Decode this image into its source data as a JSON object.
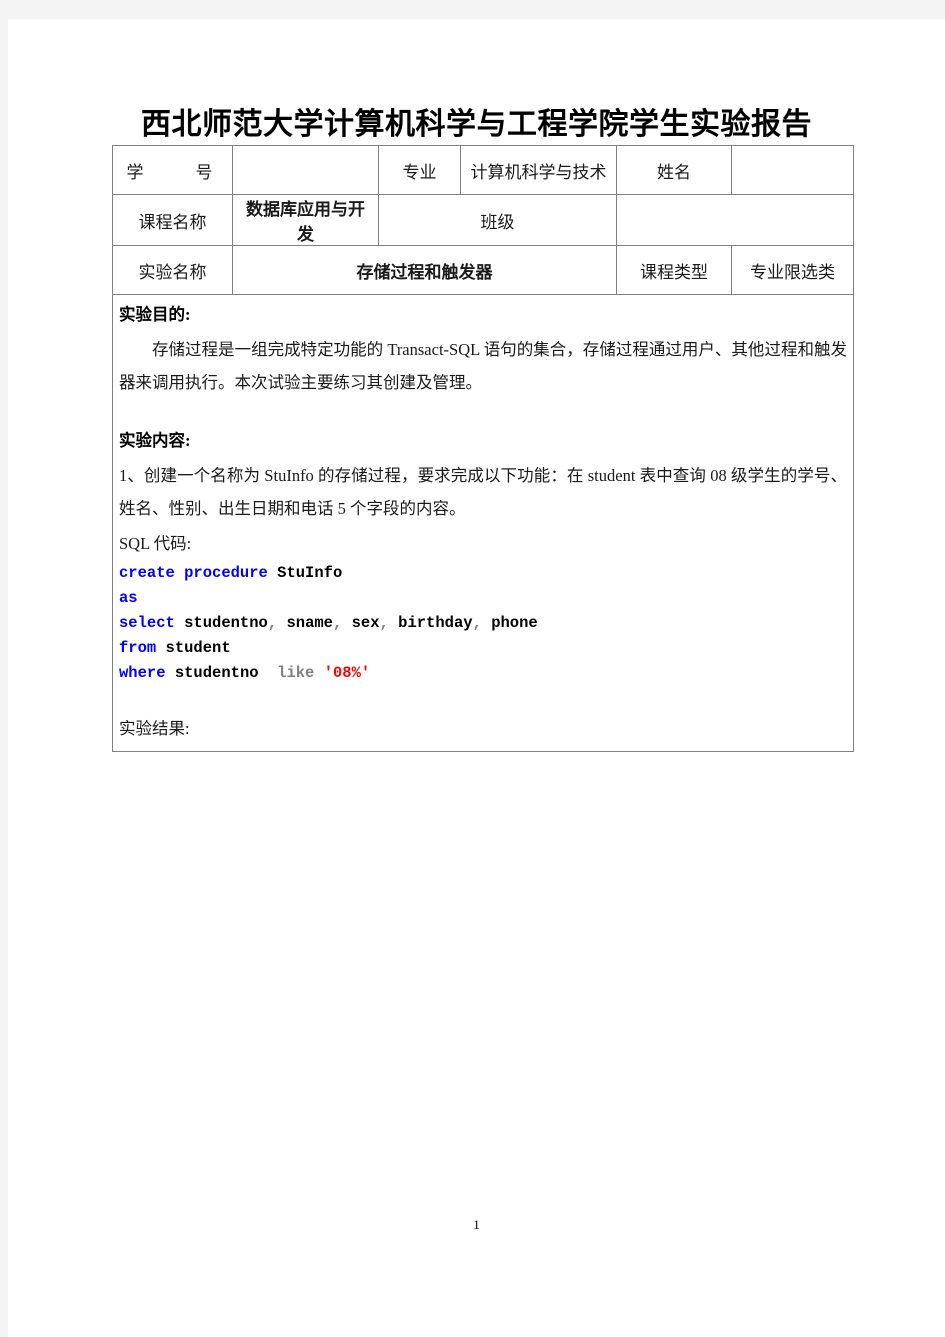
{
  "document": {
    "title": "西北师范大学计算机科学与工程学院学生实验报告",
    "page_number": "1"
  },
  "info_table": {
    "row1": {
      "label_student_id": "学　　号",
      "value_student_id": "",
      "label_major": "专业",
      "value_major": "计算机科学与技术",
      "label_name": "姓名",
      "value_name": ""
    },
    "row2": {
      "label_course_name": "课程名称",
      "value_course_name": "数据库应用与开发",
      "label_class": "班级",
      "value_class": ""
    },
    "row3": {
      "label_experiment_name": "实验名称",
      "value_experiment_name": "存储过程和触发器",
      "label_course_type": "课程类型",
      "value_course_type": "专业限选类"
    }
  },
  "body": {
    "purpose_heading": "实验目的:",
    "purpose_text": "存储过程是一组完成特定功能的 Transact-SQL 语句的集合，存储过程通过用户、其他过程和触发器来调用执行。本次试验主要练习其创建及管理。",
    "content_heading": "实验内容:",
    "content_item_1": "1、创建一个名称为 StuInfo 的存储过程，要求完成以下功能：在 student 表中查询 08 级学生的学号、姓名、性别、出生日期和电话 5 个字段的内容。",
    "sql_label": "SQL 代码:",
    "sql_code": {
      "line1": {
        "kw1": "create",
        "kw2": "procedure",
        "name": "StuInfo"
      },
      "line2": {
        "kw1": "as"
      },
      "line3": {
        "kw1": "select",
        "col1": "studentno",
        "sep1": ",",
        "col2": "sname",
        "sep2": ",",
        "col3": "sex",
        "sep3": ",",
        "col4": "birthday",
        "sep4": ",",
        "col5": "phone"
      },
      "line4": {
        "kw1": "from",
        "table": "student"
      },
      "line5": {
        "kw1": "where",
        "col": "studentno",
        "op": "like",
        "str": "'08%'"
      }
    },
    "result_label": "实验结果:"
  },
  "colors": {
    "keyword": "#0000ff",
    "identifier": "#000000",
    "operator": "#808080",
    "string": "#ff0000",
    "table_border": "#808080",
    "page_background": "#ffffff",
    "chrome_band": "#f4f4f4"
  }
}
